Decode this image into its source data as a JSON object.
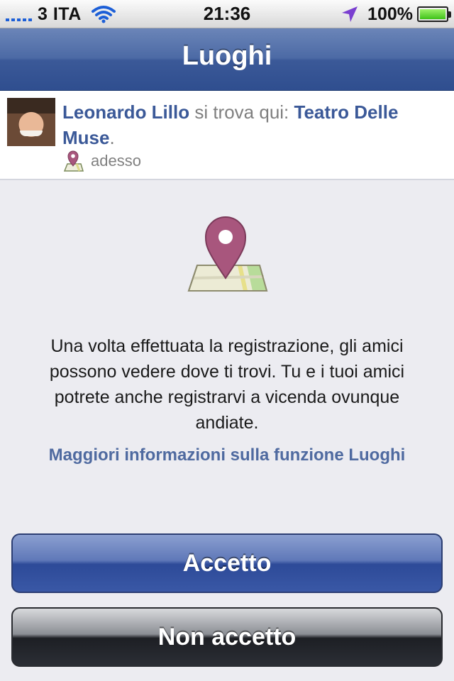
{
  "status_bar": {
    "carrier": "3 ITA",
    "time": "21:36",
    "battery_percent": "100%",
    "icons": [
      "signal-icon",
      "wifi-icon",
      "location-arrow-icon",
      "battery-icon"
    ]
  },
  "nav": {
    "title": "Luoghi"
  },
  "checkin": {
    "person": "Leonardo Lillo",
    "middle_text": " si trova qui: ",
    "place": "Teatro Delle Muse",
    "trailing": ".",
    "time": "adesso"
  },
  "body": {
    "description": "Una volta effettuata la registrazione, gli amici possono vedere dove ti trovi. Tu e i tuoi amici potrete anche registrarvi a vicenda ovunque andiate.",
    "more_info_link": "Maggiori informazioni sulla funzione Luoghi"
  },
  "buttons": {
    "accept": "Accetto",
    "decline": "Non accetto"
  },
  "colors": {
    "nav_blue": "#3b5998",
    "link_blue": "#4f6aa0",
    "pin": "#a8567d",
    "background": "#ececf1"
  }
}
